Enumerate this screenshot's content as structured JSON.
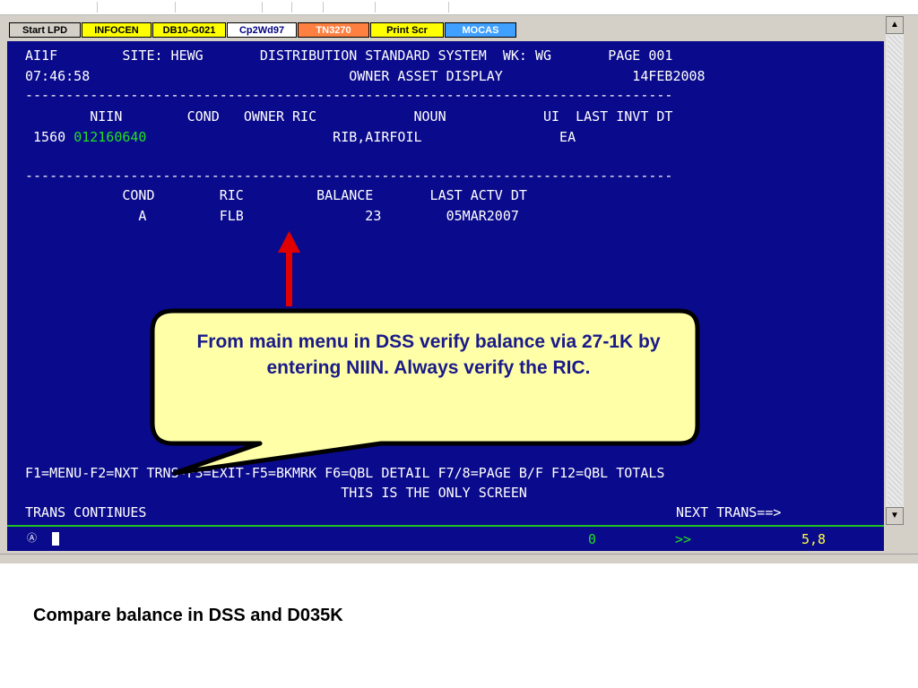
{
  "toolbar": {
    "buttons": [
      {
        "label": "Start LPD",
        "color": "#d4d0c8",
        "text_color": "#000000"
      },
      {
        "label": "INFOCEN",
        "color": "#ffff00",
        "text_color": "#000000"
      },
      {
        "label": "DB10-G021",
        "color": "#ffff00",
        "text_color": "#000000"
      },
      {
        "label": "Cp2Wd97",
        "color": "#ffffff",
        "text_color": "#000080"
      },
      {
        "label": "TN3270",
        "color": "#ff8040",
        "text_color": "#ffffff"
      },
      {
        "label": "Print Scr",
        "color": "#ffff00",
        "text_color": "#000000"
      },
      {
        "label": "MOCAS",
        "color": "#40a0ff",
        "text_color": "#ffffff"
      }
    ]
  },
  "terminal": {
    "line1": "AI1F        SITE: HEWG       DISTRIBUTION STANDARD SYSTEM  WK: WG       PAGE 001",
    "line2": "07:46:58                                OWNER ASSET DISPLAY                14FEB2008",
    "separator": "--------------------------------------------------------------------------------",
    "header1": "        NIIN        COND   OWNER RIC            NOUN            UI  LAST INVT DT",
    "row1_fsc": " 1560 ",
    "row1_niin": "012160640",
    "row1_rest": "                       RIB,AIRFOIL                 EA",
    "header2": "            COND        RIC         BALANCE       LAST ACTV DT",
    "row2": "              A         FLB               23        05MAR2007",
    "fkeys": "F1=MENU-F2=NXT TRNS-F3=EXIT-F5=BKMRK F6=QBL DETAIL F7/8=PAGE B/F F12=QBL TOTALS",
    "only_screen": "                                       THIS IS THE ONLY SCREEN",
    "trans_continues": "TRANS CONTINUES",
    "next_trans": "NEXT TRANS==>",
    "status_icon": "Ⓐ",
    "status_zero": "0",
    "status_arrows": ">>",
    "status_pos": "5,8"
  },
  "callout": {
    "text": "From main menu in DSS verify balance via 27-1K by entering NIIN.  Always verify the RIC.",
    "fill": "#ffffa8",
    "border": "#000000"
  },
  "arrow_color": "#e00000",
  "terminal_bg": "#0a0a8c",
  "terminal_green": "#22e022",
  "caption": "Compare balance in DSS and D035K"
}
